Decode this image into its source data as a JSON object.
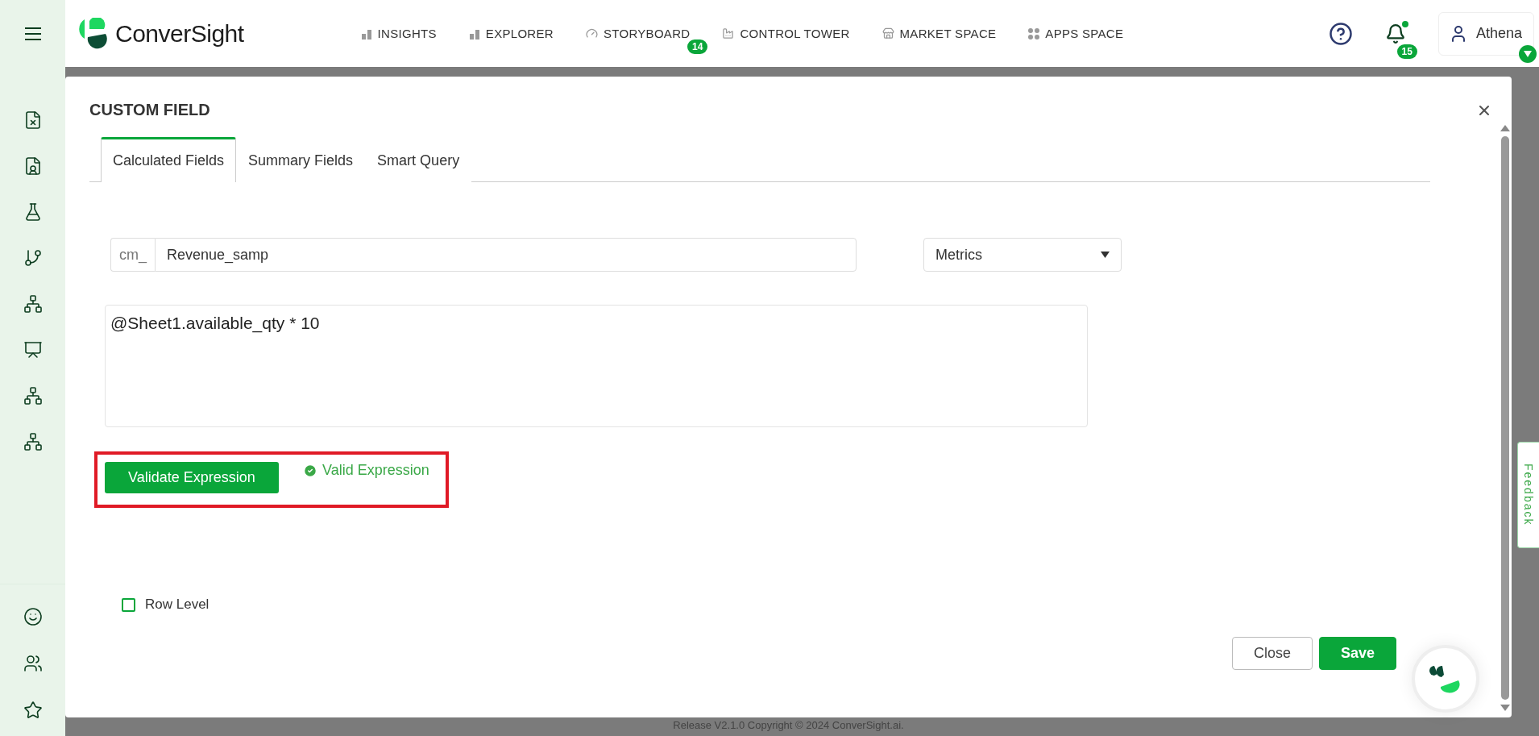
{
  "header": {
    "brand": "ConverSight",
    "nav": [
      {
        "label": "INSIGHTS",
        "kind": "bars"
      },
      {
        "label": "EXPLORER",
        "kind": "bars"
      },
      {
        "label": "STORYBOARD",
        "kind": "gauge",
        "badge": "14"
      },
      {
        "label": "CONTROL TOWER",
        "kind": "factory"
      },
      {
        "label": "MARKET SPACE",
        "kind": "store"
      },
      {
        "label": "APPS SPACE",
        "kind": "dots"
      }
    ],
    "notifications": "15",
    "unread": true,
    "user": "Athena"
  },
  "sidebar": {
    "items": [
      {
        "kind": "sheet"
      },
      {
        "kind": "report"
      },
      {
        "kind": "flask"
      },
      {
        "kind": "branch"
      },
      {
        "kind": "sitemap"
      },
      {
        "kind": "presentation"
      },
      {
        "kind": "sitemap"
      },
      {
        "kind": "sitemap"
      }
    ],
    "bottom_items": [
      {
        "kind": "bot"
      },
      {
        "kind": "users"
      },
      {
        "kind": "star"
      }
    ]
  },
  "modal": {
    "title": "CUSTOM FIELD",
    "tabs": [
      {
        "label": "Calculated Fields",
        "selected": true
      },
      {
        "label": "Summary Fields",
        "selected": false
      },
      {
        "label": "Smart Query",
        "selected": false
      }
    ],
    "name_prefix": "cm_",
    "name_value": "Revenue_samp",
    "type": "Metrics",
    "expression": "@Sheet1.available_qty * 10",
    "validate_button": "Validate Expression",
    "highlighted": true,
    "status": {
      "text": "Valid Expression",
      "valid": true
    },
    "row_level": {
      "label": "Row Level",
      "checked": false
    },
    "buttons": [
      {
        "label": "Close",
        "kind": "secondary"
      },
      {
        "label": "Save",
        "kind": "primary"
      }
    ]
  },
  "feedback": "Feedback",
  "footer": "Release V2.1.0 Copyright © 2024 ConverSight.ai."
}
